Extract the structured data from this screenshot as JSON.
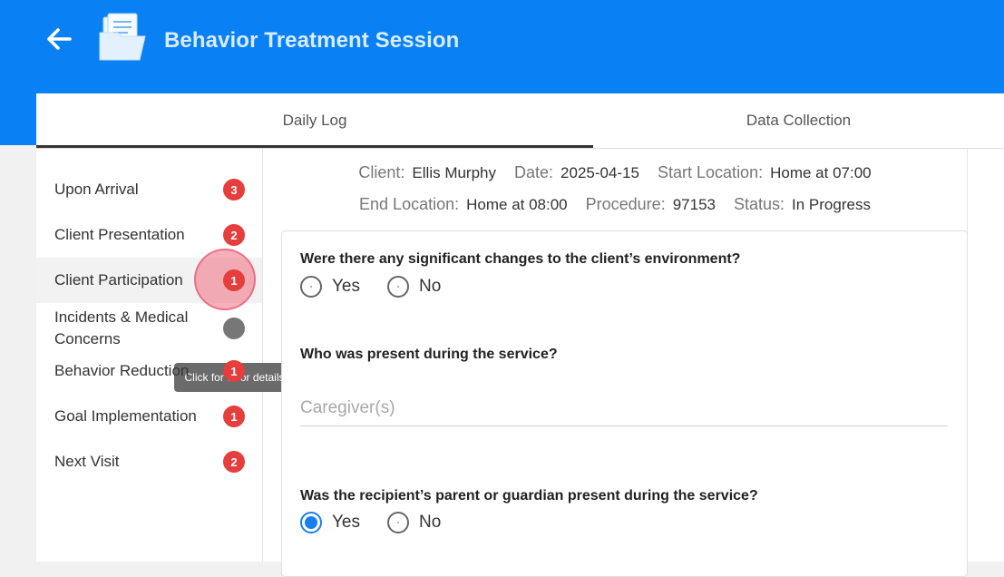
{
  "header": {
    "title": "Behavior Treatment Session",
    "accent": "#0a80f5"
  },
  "tabs": [
    {
      "label": "Daily Log",
      "active": true
    },
    {
      "label": "Data Collection",
      "active": false
    }
  ],
  "sidebar": {
    "items": [
      {
        "label": "Upon Arrival",
        "badge": "3"
      },
      {
        "label": "Client Presentation",
        "badge": "2"
      },
      {
        "label": "Client Participation",
        "badge": "1"
      },
      {
        "label": "Incidents & Medical Concerns",
        "badge": ""
      },
      {
        "label": "Behavior Reduction",
        "badge": "1"
      },
      {
        "label": "Goal Implementation",
        "badge": "1"
      },
      {
        "label": "Next Visit",
        "badge": "2"
      }
    ],
    "badge_color": "#e63d3d"
  },
  "tooltip": {
    "text": "Click for error details"
  },
  "meta": {
    "client_label": "Client:",
    "client_value": "Ellis Murphy",
    "date_label": "Date:",
    "date_value": "2025-04-15",
    "start_label": "Start Location:",
    "start_value": "Home at 07:00",
    "end_label": "End Location:",
    "end_value": "Home at 08:00",
    "procedure_label": "Procedure:",
    "procedure_value": "97153",
    "status_label": "Status:",
    "status_value": "In Progress"
  },
  "form": {
    "q1": {
      "text": "Were there any significant changes to the client’s environment?",
      "yes_label": "Yes",
      "no_label": "No",
      "selected": ""
    },
    "q2": {
      "text": "Who was present during the service?",
      "placeholder": "Caregiver(s)",
      "value": ""
    },
    "q3": {
      "text": "Was the recipient’s parent or guardian present during the service?",
      "yes_label": "Yes",
      "no_label": "No",
      "selected": "Yes"
    }
  }
}
